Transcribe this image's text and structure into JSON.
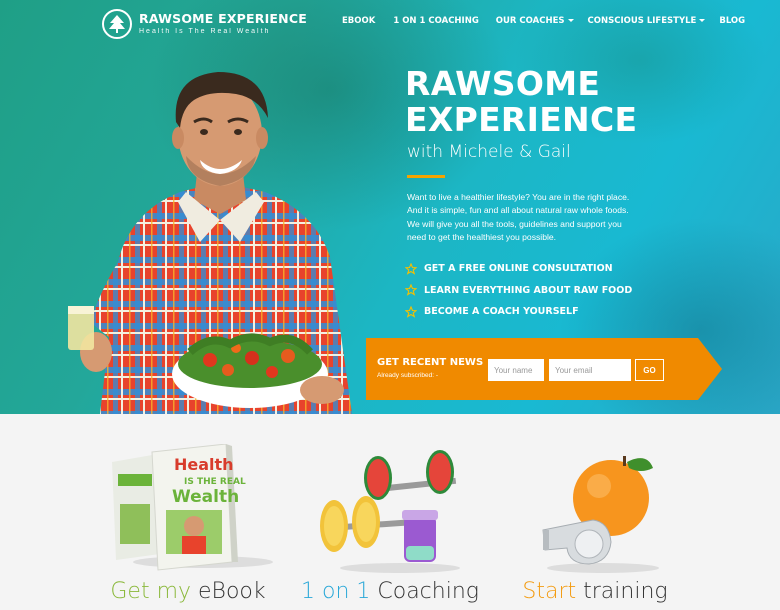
{
  "brand": {
    "name": "RAWSOME EXPERIENCE",
    "tagline": "Health Is The Real Wealth"
  },
  "nav": [
    {
      "label": "eBOOK",
      "dropdown": false
    },
    {
      "label": "1 ON 1 COACHING",
      "dropdown": false
    },
    {
      "label": "OUR COACHES",
      "dropdown": true
    },
    {
      "label": "CONSCIOUS LIFESTYLE",
      "dropdown": true
    },
    {
      "label": "BLOG",
      "dropdown": false
    }
  ],
  "hero": {
    "title_line1": "RAWSOME",
    "title_line2": "EXPERIENCE",
    "subtitle": "with Michele & Gail",
    "desc_lines": [
      "Want to live a healthier lifestyle? You are in the right place.",
      "And it is simple, fun and all about natural raw whole foods.",
      "We will give you all the tools, guidelines and support you",
      "need to get the healthiest you possible."
    ],
    "features": [
      "GET A FREE ONLINE CONSULTATION",
      "LEARN EVERYTHING ABOUT RAW FOOD",
      "BECOME A COACH YOURSELF"
    ]
  },
  "newsletter": {
    "title": "GET RECENT NEWS",
    "note": "Already subscribed: -",
    "name_placeholder": "Your name",
    "email_placeholder": "Your email",
    "button": "GO"
  },
  "cards": [
    {
      "accent": "Get my",
      "rest": " eBook",
      "accent_color": "#8ab83a"
    },
    {
      "accent": "1 on 1",
      "rest": " Coaching",
      "accent_color": "#29a8d8"
    },
    {
      "accent": "Start",
      "rest": " training",
      "accent_color": "#f39c12"
    }
  ],
  "colors": {
    "orange": "#f08a00",
    "star": "#f5c000",
    "rule": "#f5a400"
  },
  "icons": [
    "tree-logo-icon",
    "chevron-down-icon",
    "star-icon"
  ]
}
